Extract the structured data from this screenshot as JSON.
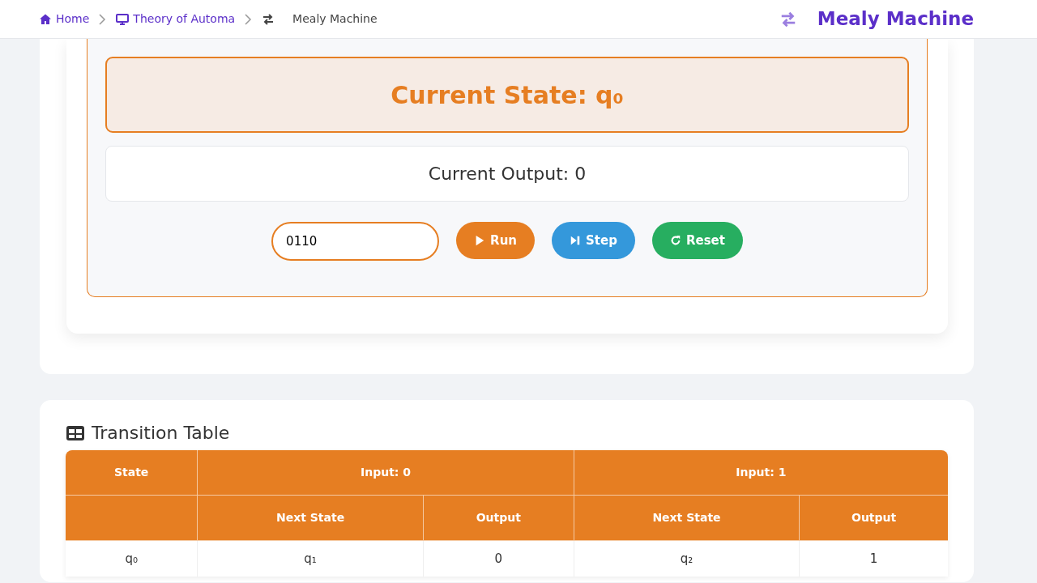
{
  "breadcrumb": [
    {
      "label": "Home",
      "current": false
    },
    {
      "label": "Theory of Automa",
      "current": false
    },
    {
      "label": "Mealy Machine",
      "current": true
    }
  ],
  "header_title": {
    "label": "Mealy Machine"
  },
  "execution": {
    "current_state": "Current State: q₀",
    "current_output": "Current Output: 0",
    "input": {
      "value": "0110"
    },
    "buttons": [
      {
        "label": "Run",
        "kind": "run"
      },
      {
        "label": "Step",
        "kind": "step"
      },
      {
        "label": "Reset",
        "kind": "reset"
      }
    ]
  },
  "transition_table": {
    "title": "Transition Table",
    "header_row_1": [
      "State",
      "Input: 0",
      "Input: 1"
    ],
    "header_row_2": [
      "Next State",
      "Output",
      "Next State",
      "Output"
    ],
    "rows": [
      [
        "q₀",
        "q₁",
        "0",
        "q₂",
        "1"
      ]
    ]
  }
}
